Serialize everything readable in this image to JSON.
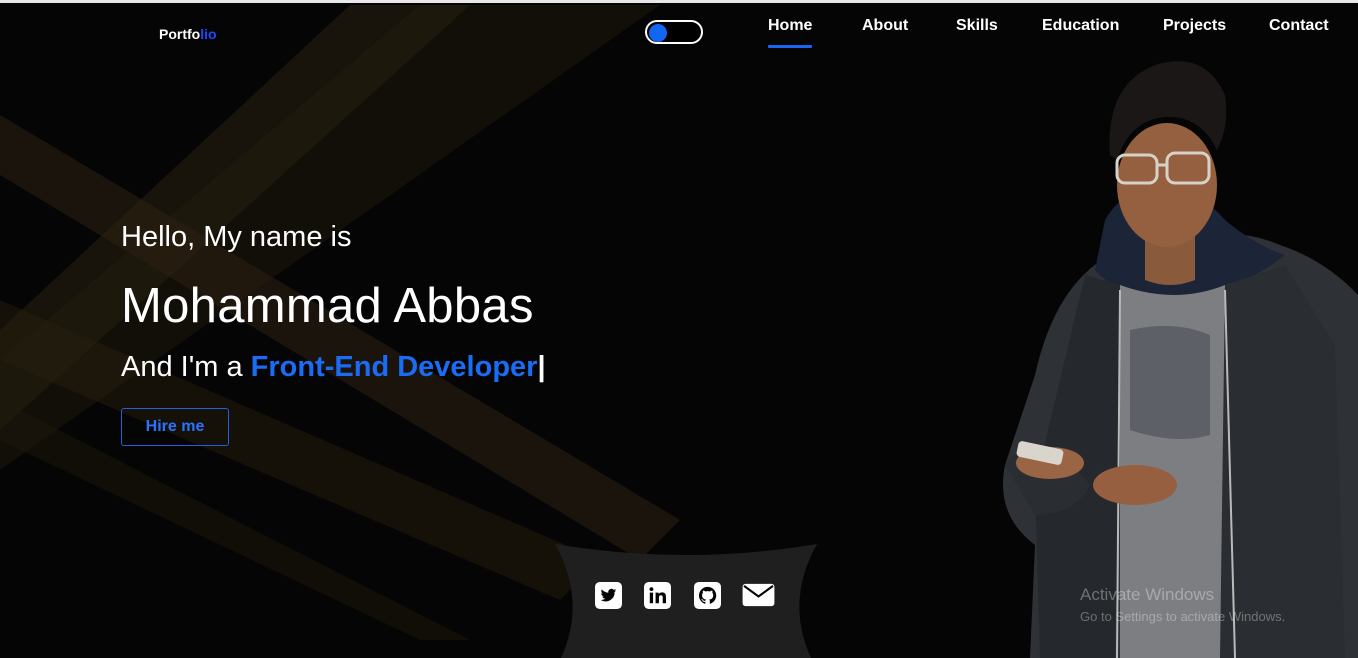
{
  "header": {
    "logo_main": "Portfo",
    "logo_accent": "lio",
    "nav": [
      "Home",
      "About",
      "Skills",
      "Education",
      "Projects",
      "Contact"
    ],
    "active_nav": "Home"
  },
  "hero": {
    "greeting": "Hello, My name is",
    "name": "Mohammad Abbas",
    "role_prefix": "And I'm a ",
    "role_highlight": "Front-End Developer",
    "cursor": "|",
    "cta_label": "Hire me"
  },
  "social": {
    "icons": [
      "twitter-icon",
      "linkedin-icon",
      "github-icon",
      "envelope-icon"
    ]
  },
  "watermark": {
    "line1": "Activate Windows",
    "line2": "Go to Settings to activate Windows."
  },
  "colors": {
    "background": "#050505",
    "accent": "#1a6cf5",
    "nav_underline": "#1c64f2"
  }
}
